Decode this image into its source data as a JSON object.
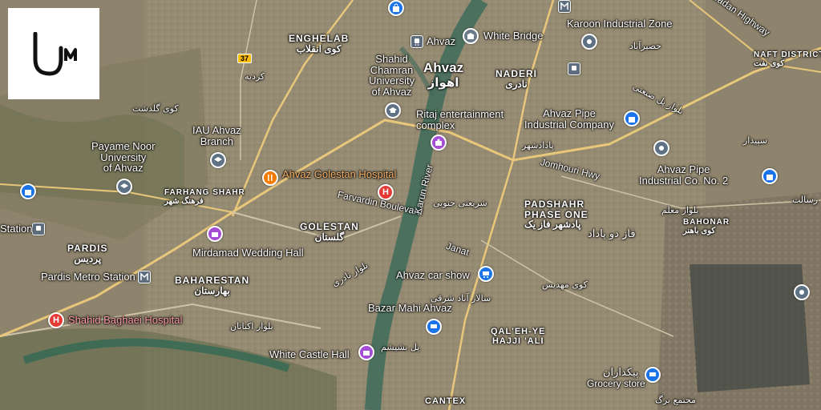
{
  "map": {
    "city_labels": {
      "ahvaz_en": "Ahvaz",
      "ahvaz_fa": "اهواز"
    },
    "districts": {
      "enghelab_en": "ENGHELAB",
      "enghelab_fa": "کوی انقلاب",
      "naderi_en": "NADERI",
      "naderi_fa": "نادری",
      "farhang_shahr_en": "FARHANG SHAHR",
      "farhang_shahr_fa": "فرهنگ شهر",
      "golestan_en": "GOLESTAN",
      "golestan_fa": "گلستان",
      "padshahr_en_1": "PADSHAHR",
      "padshahr_en_2": "PHASE ONE",
      "padshahr_fa": "پادشهر فاز یک",
      "pardis_en": "PARDIS",
      "pardis_fa": "پردیس",
      "baharestan_en": "BAHARESTAN",
      "baharestan_fa": "بهارستان",
      "bahonar_en": "BAHONAR",
      "bahonar_fa": "کوی باهنر",
      "qaleh_1": "QAL'EH-YE",
      "qaleh_2": "HAJJI 'ALI",
      "naft_en": "NAFT DISTRICT",
      "naft_fa": "کوی نفت",
      "cantex": "CANTEX"
    },
    "places": {
      "white_bridge": "White Bridge",
      "karoon_industrial": "Karoon Industrial Zone",
      "karoon_fa": "حصیرآباد",
      "shahid_chamran_1": "Shahid",
      "shahid_chamran_2": "Chamran",
      "shahid_chamran_3": "University",
      "shahid_chamran_4": "of Ahvaz",
      "ritaj_1": "Ritaj entertainment",
      "ritaj_2": "complex",
      "ahvaz_pipe_1": "Ahvaz Pipe",
      "ahvaz_pipe_2": "Industrial Company",
      "ahvaz_pipe_no2_1": "Ahvaz Pipe",
      "ahvaz_pipe_no2_2": "Industrial Co. No. 2",
      "iau_1": "IAU Ahvaz",
      "iau_2": "Branch",
      "payame_1": "Payame Noor",
      "payame_2": "University",
      "payame_3": "of Ahvaz",
      "golestan_hospital": "Ahvaz Golestan Hospital",
      "mirdamad": "Mirdamad Wedding Hall",
      "pardis_metro": "Pardis Metro Station",
      "station": "Station",
      "shahid_baghaei": "Shahid Baghaei Hospital",
      "ahvaz_car_show": "Ahvaz car show",
      "bazar_mahi": "Bazar Mahi Ahvaz",
      "white_castle": "White Castle Hall",
      "grocery": "Grocery store",
      "grocery_fa": "پیکداران",
      "ahvaz_station": "Ahvaz",
      "kooye_golshasht": "کوی گلدشت",
      "kardeh_fa": "کردیه",
      "padadshahr_fa": "پادادشهر",
      "padshahr_fa2": "فاز دو پاداد",
      "sepidar_fa": "سپیدار",
      "moalem_fa": "بلوار معلم",
      "kooye_mehdis_fa": "کوی مهدیس",
      "salar_fa": "سالار آباد شرقی",
      "ekbatan_fa": "بلوار اکباتان",
      "pol_fa": "پل بشیشم",
      "boulevard_fa": "بلوار نادری",
      "shariati_fa": "شریعتی جنوبی",
      "rasalat_fa": "رسالت",
      "majma_fa": "مجتمع برگ",
      "pol_abadan_fa": "بلوار پل صنعتی"
    },
    "roads": {
      "farvardin": "Farvardin Boulevard",
      "karun_river": "Karun River",
      "jomhouri": "Jomhouri Hwy",
      "janat": "Janat",
      "route_37": "37",
      "abadan_hwy": "Abadan Highway"
    },
    "colors": {
      "river": "#3f6b5a",
      "road_major": "#e8c77a",
      "road_minor": "#cfc3a6",
      "pin_blue": "#1a73e8",
      "pin_purple": "#a64dd6",
      "pin_red": "#e53935",
      "pin_orange": "#f57c00"
    }
  },
  "logo": {
    "icon": "um-logo-icon",
    "background": "#ffffff"
  }
}
